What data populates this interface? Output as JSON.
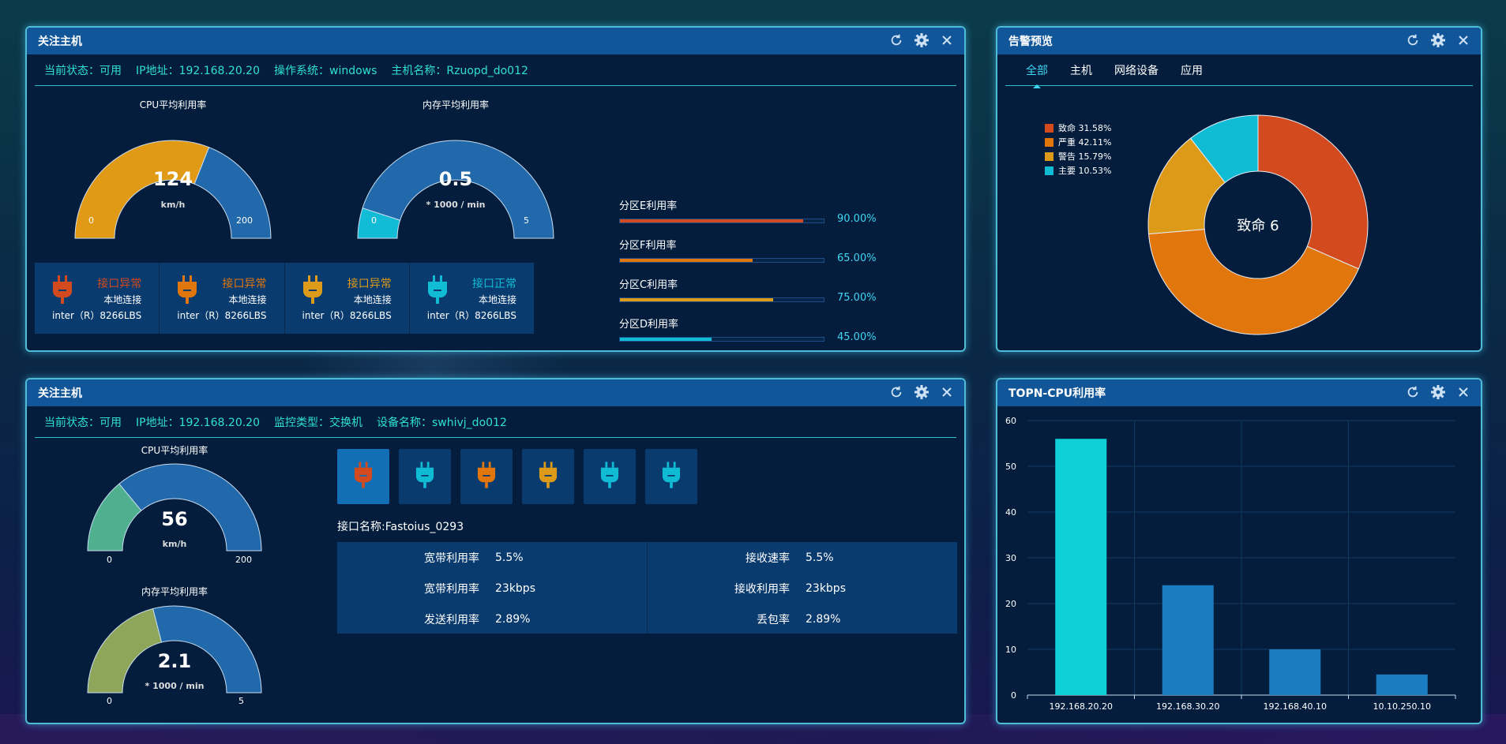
{
  "colors": {
    "fatal": "#d24a1e",
    "severe": "#e0760c",
    "warning": "#dd9a18",
    "major": "#10bcd4",
    "gauge_orange": "#e09a16",
    "gauge_blue": "#2169aa",
    "gauge_cyan": "#13bcd6",
    "gauge_green": "#4fb08f",
    "gauge_olive": "#8ea65a",
    "bar_teal": "#0fd0d6",
    "bar_blue": "#1c7cc2"
  },
  "panel1": {
    "title": "关注主机",
    "info": [
      "当前状态：可用",
      "IP地址：192.168.20.20",
      "操作系统：windows",
      "主机名称：Rzuopd_do012"
    ],
    "gauge_cpu": {
      "label": "CPU平均利用率",
      "value": "124",
      "unit": "km/h",
      "min": "0",
      "max": "200",
      "fraction": 0.62
    },
    "gauge_mem": {
      "label": "内存平均利用率",
      "value": "0.5",
      "unit": "* 1000 / min",
      "min": "0",
      "max": "5",
      "fraction": 0.1
    },
    "cards": [
      {
        "status": "接口异常",
        "conn": "本地连接",
        "device": "inter（R）8266LBS",
        "color": "#d24a1e",
        "icon": "plug-icon"
      },
      {
        "status": "接口异常",
        "conn": "本地连接",
        "device": "inter（R）8266LBS",
        "color": "#e0760c",
        "icon": "plug-icon"
      },
      {
        "status": "接口异常",
        "conn": "本地连接",
        "device": "inter（R）8266LBS",
        "color": "#dd9a18",
        "icon": "plug-icon"
      },
      {
        "status": "接口正常",
        "conn": "本地连接",
        "device": "inter（R）8266LBS",
        "color": "#10bcd4",
        "icon": "plug-icon"
      }
    ],
    "bars": [
      {
        "label": "分区E利用率",
        "pct": "90.00%",
        "value": 0.9,
        "color": "#d24a1e"
      },
      {
        "label": "分区F利用率",
        "pct": "65.00%",
        "value": 0.65,
        "color": "#e0760c"
      },
      {
        "label": "分区C利用率",
        "pct": "75.00%",
        "value": 0.75,
        "color": "#dd9a18"
      },
      {
        "label": "分区D利用率",
        "pct": "45.00%",
        "value": 0.45,
        "color": "#10bcd4"
      }
    ]
  },
  "panel2": {
    "title": "告警预览",
    "tabs": [
      "全部",
      "主机",
      "网络设备",
      "应用"
    ],
    "center": "致命 6",
    "legend": [
      {
        "name": "致命 31.58%",
        "color": "#d24a1e"
      },
      {
        "name": "严重 42.11%",
        "color": "#e0760c"
      },
      {
        "name": "警告 15.79%",
        "color": "#dd9a18"
      },
      {
        "name": "主要 10.53%",
        "color": "#10bcd4"
      }
    ],
    "chart_data": {
      "type": "pie",
      "categories": [
        "致命",
        "严重",
        "警告",
        "主要"
      ],
      "values": [
        31.58,
        42.11,
        15.79,
        10.53
      ]
    }
  },
  "panel3": {
    "title": "关注主机",
    "info": [
      "当前状态：可用",
      "IP地址：192.168.20.20",
      "监控类型：交换机",
      "设备名称：swhivj_do012"
    ],
    "gauge_cpu": {
      "label": "CPU平均利用率",
      "value": "56",
      "unit": "km/h",
      "min": "0",
      "max": "200",
      "fraction": 0.28
    },
    "gauge_mem": {
      "label": "内存平均利用率",
      "value": "2.1",
      "unit": "* 1000 / min",
      "min": "0",
      "max": "5",
      "fraction": 0.42
    },
    "icons": [
      {
        "color": "#d24a1e",
        "name": "plug-icon",
        "selected": true
      },
      {
        "color": "#10bcd4",
        "name": "plug-icon"
      },
      {
        "color": "#e0760c",
        "name": "plug-icon"
      },
      {
        "color": "#dd9a18",
        "name": "plug-icon"
      },
      {
        "color": "#10bcd4",
        "name": "plug-icon"
      },
      {
        "color": "#10bcd4",
        "name": "plug-icon"
      }
    ],
    "iface_name": "接口名称:Fastoius_0293",
    "stats_left": [
      {
        "k": "宽带利用率",
        "v": "5.5%"
      },
      {
        "k": "宽带利用率",
        "v": "23kbps"
      },
      {
        "k": "发送利用率",
        "v": "2.89%"
      }
    ],
    "stats_right": [
      {
        "k": "接收速率",
        "v": "5.5%"
      },
      {
        "k": "接收利用率",
        "v": "23kbps"
      },
      {
        "k": "丢包率",
        "v": "2.89%"
      }
    ]
  },
  "panel4": {
    "title": "TOPN-CPU利用率",
    "chart_data": {
      "type": "bar",
      "categories": [
        "192.168.20.20",
        "192.168.30.20",
        "192.168.40.10",
        "10.10.250.10"
      ],
      "values": [
        56,
        24,
        10,
        4.5
      ],
      "ylim": [
        0,
        60
      ],
      "yticks": [
        0,
        10,
        20,
        30,
        40,
        50,
        60
      ],
      "grid": true
    }
  }
}
